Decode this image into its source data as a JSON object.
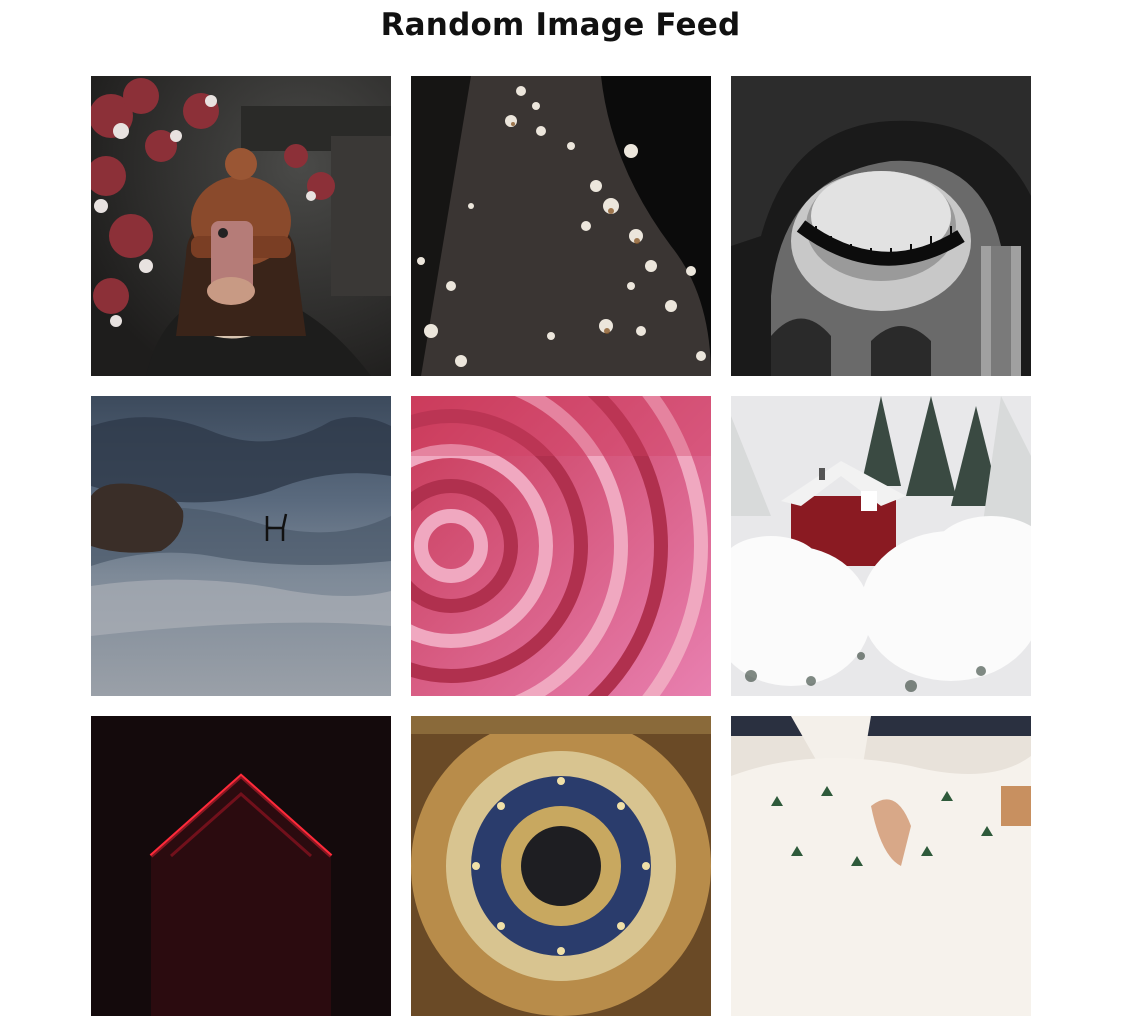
{
  "header": {
    "title": "Random Image Feed"
  },
  "feed": {
    "images": [
      {
        "name": "photo-woman-phone-snow"
      },
      {
        "name": "photo-dark-rock-pebbles"
      },
      {
        "name": "photo-spiral-staircase-bw"
      },
      {
        "name": "photo-chair-in-sea"
      },
      {
        "name": "photo-pink-spiral"
      },
      {
        "name": "photo-red-house-snow"
      },
      {
        "name": "photo-red-neon-roof"
      },
      {
        "name": "photo-ornate-dome-ceiling"
      },
      {
        "name": "photo-folding-linen"
      }
    ]
  }
}
